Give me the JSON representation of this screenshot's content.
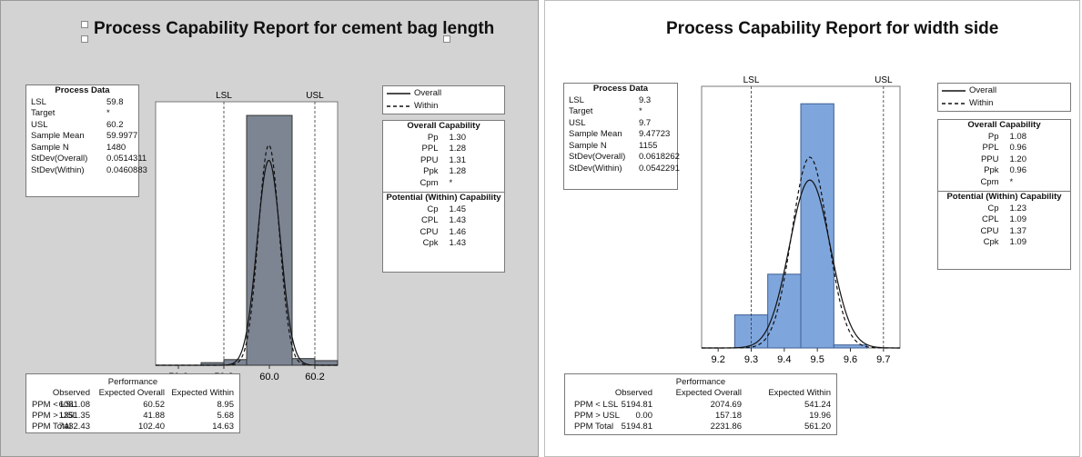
{
  "chart_data": [
    {
      "type": "histogram",
      "title": "Process Capability Report for cement bag length",
      "spec_lines": {
        "LSL": 59.8,
        "USL": 60.2
      },
      "spec_labels": [
        "LSL",
        "USL"
      ],
      "x_ticks": [
        "59.6",
        "59.8",
        "60.0",
        "60.2"
      ],
      "xlim": [
        59.5,
        60.3
      ],
      "bins": [
        {
          "x0": 59.7,
          "x1": 59.8,
          "height": 0.01
        },
        {
          "x0": 59.8,
          "x1": 59.9,
          "height": 0.022
        },
        {
          "x0": 59.9,
          "x1": 60.1,
          "height": 0.975
        },
        {
          "x0": 60.1,
          "x1": 60.2,
          "height": 0.026
        },
        {
          "x0": 60.2,
          "x1": 60.3,
          "height": 0.018
        }
      ],
      "curves": {
        "overall_sigma": 0.0514311,
        "within_sigma": 0.0460883,
        "mean": 59.9977,
        "overall_peak": 0.8,
        "within_peak": 0.86
      },
      "colors": {
        "bar": "#7d8593",
        "background": "#d3d3d3"
      },
      "legend": [
        "Overall",
        "Within"
      ],
      "process_data": {
        "header": "Process Data",
        "rows": [
          [
            "LSL",
            "59.8"
          ],
          [
            "Target",
            "*"
          ],
          [
            "USL",
            "60.2"
          ],
          [
            "Sample Mean",
            "59.9977"
          ],
          [
            "Sample N",
            "1480"
          ],
          [
            "StDev(Overall)",
            "0.0514311"
          ],
          [
            "StDev(Within)",
            "0.0460883"
          ]
        ]
      },
      "overall_capability": {
        "header": "Overall Capability",
        "rows": [
          [
            "Pp",
            "1.30"
          ],
          [
            "PPL",
            "1.28"
          ],
          [
            "PPU",
            "1.31"
          ],
          [
            "Ppk",
            "1.28"
          ],
          [
            "Cpm",
            "*"
          ]
        ]
      },
      "within_capability": {
        "header": "Potential (Within) Capability",
        "rows": [
          [
            "Cp",
            "1.45"
          ],
          [
            "CPL",
            "1.43"
          ],
          [
            "CPU",
            "1.46"
          ],
          [
            "Cpk",
            "1.43"
          ]
        ]
      },
      "performance": {
        "header": "Performance",
        "columns": [
          "Observed",
          "Expected Overall",
          "Expected Within"
        ],
        "rows": [
          [
            "PPM < LSL",
            "6081.08",
            "60.52",
            "8.95"
          ],
          [
            "PPM > USL",
            "1351.35",
            "41.88",
            "5.68"
          ],
          [
            "PPM Total",
            "7432.43",
            "102.40",
            "14.63"
          ]
        ]
      }
    },
    {
      "type": "histogram",
      "title": "Process Capability Report for width side",
      "spec_lines": {
        "LSL": 9.3,
        "USL": 9.7
      },
      "spec_labels": [
        "LSL",
        "USL"
      ],
      "x_ticks": [
        "9.2",
        "9.3",
        "9.4",
        "9.5",
        "9.6",
        "9.7"
      ],
      "xlim": [
        9.15,
        9.75
      ],
      "bins": [
        {
          "x0": 9.25,
          "x1": 9.35,
          "height": 0.13
        },
        {
          "x0": 9.35,
          "x1": 9.45,
          "height": 0.29
        },
        {
          "x0": 9.45,
          "x1": 9.55,
          "height": 0.96
        },
        {
          "x0": 9.55,
          "x1": 9.65,
          "height": 0.012
        }
      ],
      "curves": {
        "overall_sigma": 0.0618262,
        "within_sigma": 0.0542291,
        "mean": 9.47723,
        "overall_peak": 0.66,
        "within_peak": 0.75
      },
      "colors": {
        "bar": "#7fa6dc",
        "bar_edge": "#3d5f93",
        "background": "#ffffff"
      },
      "legend": [
        "Overall",
        "Within"
      ],
      "process_data": {
        "header": "Process Data",
        "rows": [
          [
            "LSL",
            "9.3"
          ],
          [
            "Target",
            "*"
          ],
          [
            "USL",
            "9.7"
          ],
          [
            "Sample Mean",
            "9.47723"
          ],
          [
            "Sample N",
            "1155"
          ],
          [
            "StDev(Overall)",
            "0.0618262"
          ],
          [
            "StDev(Within)",
            "0.0542291"
          ]
        ]
      },
      "overall_capability": {
        "header": "Overall Capability",
        "rows": [
          [
            "Pp",
            "1.08"
          ],
          [
            "PPL",
            "0.96"
          ],
          [
            "PPU",
            "1.20"
          ],
          [
            "Ppk",
            "0.96"
          ],
          [
            "Cpm",
            "*"
          ]
        ]
      },
      "within_capability": {
        "header": "Potential (Within) Capability",
        "rows": [
          [
            "Cp",
            "1.23"
          ],
          [
            "CPL",
            "1.09"
          ],
          [
            "CPU",
            "1.37"
          ],
          [
            "Cpk",
            "1.09"
          ]
        ]
      },
      "performance": {
        "header": "Performance",
        "columns": [
          "Observed",
          "Expected Overall",
          "Expected Within"
        ],
        "rows": [
          [
            "PPM < LSL",
            "5194.81",
            "2074.69",
            "541.24"
          ],
          [
            "PPM > USL",
            "0.00",
            "157.18",
            "19.96"
          ],
          [
            "PPM Total",
            "5194.81",
            "2231.86",
            "561.20"
          ]
        ]
      }
    }
  ]
}
